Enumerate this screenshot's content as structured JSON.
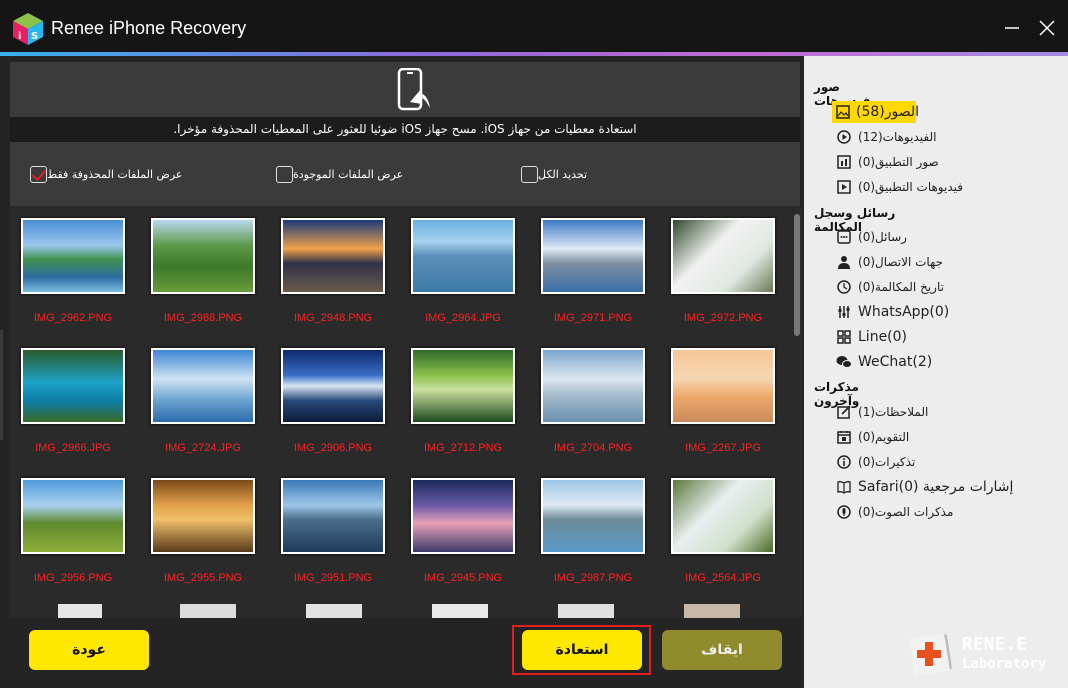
{
  "window": {
    "title": "Renee iPhone Recovery",
    "logo_text": "iS"
  },
  "header": {
    "instruction": "استعادة معطيات من جهاز iOS. مسح جهاز iOS ضوئيا للعثور على المعطيات المحذوفة مؤخرا."
  },
  "options": {
    "show_deleted_only": "عرض الملفات المحذوفة فقط",
    "show_existing": "عرض الملفات الموجودة",
    "select_all": "تحديد الكل"
  },
  "photos": [
    {
      "name": "IMG_2962.PNG"
    },
    {
      "name": "IMG_2988.PNG"
    },
    {
      "name": "IMG_2948.PNG"
    },
    {
      "name": "IMG_2964.JPG"
    },
    {
      "name": "IMG_2971.PNG"
    },
    {
      "name": "IMG_2972.PNG"
    },
    {
      "name": "IMG_2966.JPG"
    },
    {
      "name": "IMG_2724.JPG"
    },
    {
      "name": "IMG_2906.PNG"
    },
    {
      "name": "IMG_2712.PNG"
    },
    {
      "name": "IMG_2704.PNG"
    },
    {
      "name": "IMG_2267.JPG"
    },
    {
      "name": "IMG_2956.PNG"
    },
    {
      "name": "IMG_2955.PNG"
    },
    {
      "name": "IMG_2951.PNG"
    },
    {
      "name": "IMG_2945.PNG"
    },
    {
      "name": "IMG_2987.PNG"
    },
    {
      "name": "IMG_2564.JPG"
    }
  ],
  "buttons": {
    "back": "عودة",
    "recover": "استعادة",
    "stop": "ايقاف"
  },
  "sidebar": {
    "section_media": "صور وفيديوهات",
    "section_messages": "رسائل وسجل المكالمة",
    "section_notes": "مذكرات وآخرون",
    "items": {
      "photos": "الصور(58)",
      "videos": "الفيديوهات(12)",
      "app_photos": "صور التطبيق(0)",
      "app_videos": "فيديوهات التطبيق(0)",
      "messages": "رسائل(0)",
      "contacts": "جهات الاتصال(0)",
      "call_history": "تاريخ المكالمة(0)",
      "whatsapp": "WhatsApp(0)",
      "line": "Line(0)",
      "wechat": "WeChat(2)",
      "notes": "الملاحظات(1)",
      "calendar": "التقويم(0)",
      "reminders": "تذكيرات(0)",
      "safari": "إشارات مرجعية Safari(0)",
      "voice_memos": "مذكرات الصوت(0)"
    }
  },
  "brand": {
    "line1": "RENE.E",
    "line2": "Laboratory"
  },
  "colors": {
    "accent_yellow": "#ffe800",
    "filename_red": "#ff2020",
    "stop_disabled": "#8f8a2b"
  }
}
